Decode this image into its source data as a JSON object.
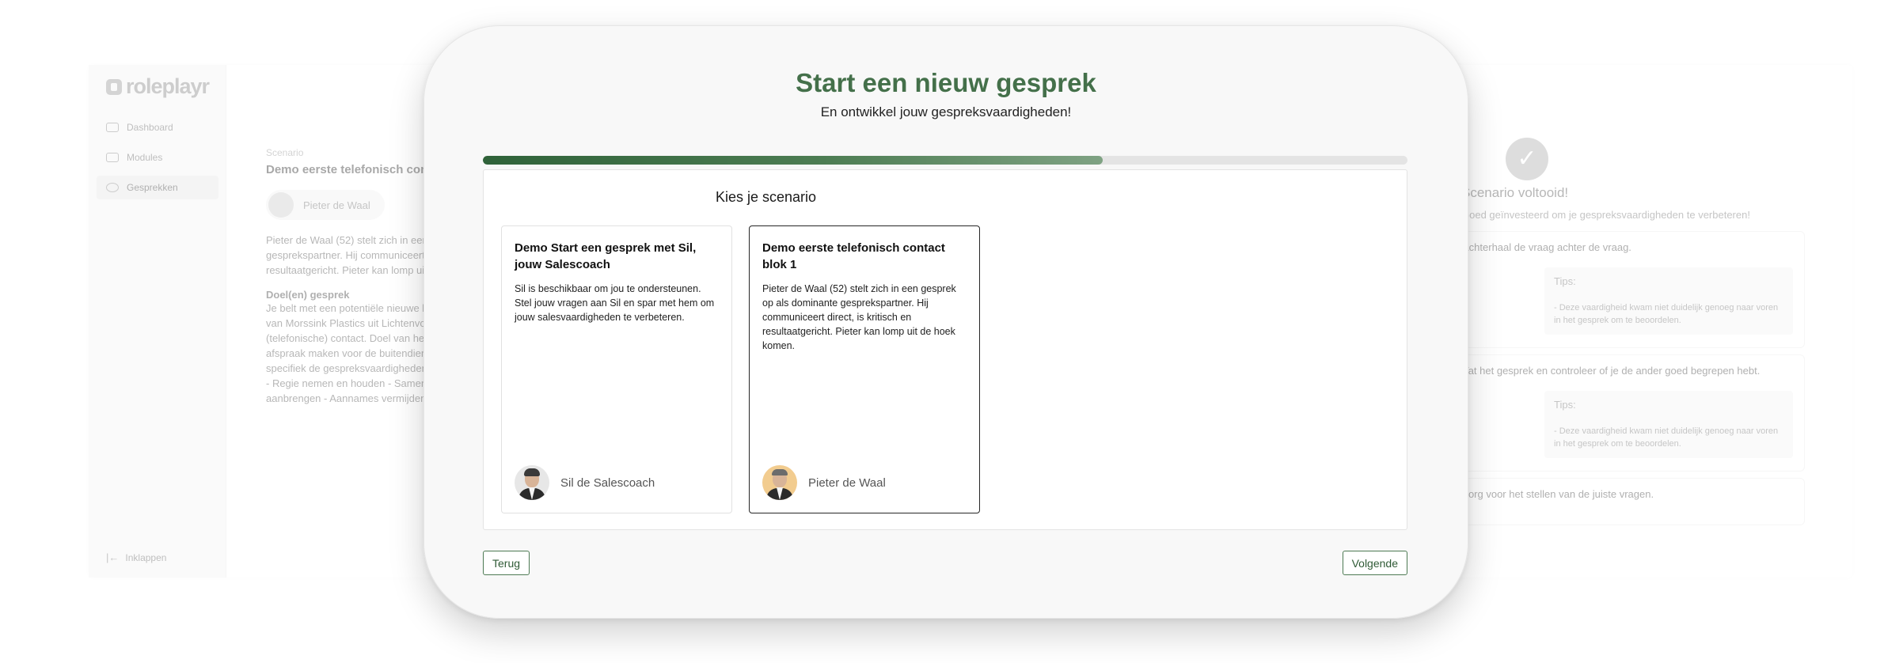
{
  "bg_left": {
    "logo": "roleplayr",
    "nav": [
      {
        "label": "Dashboard"
      },
      {
        "label": "Modules"
      },
      {
        "label": "Gesprekken"
      }
    ],
    "collapse": "Inklappen",
    "scenario_label": "Scenario",
    "scenario_title": "Demo eerste telefonisch contact blok 1",
    "persona": "Pieter de Waal",
    "description": "Pieter de Waal (52) stelt zich in een gesprek op als dominante gesprekspartner. Hij communiceert direct, is kritisch en resultaatgericht. Pieter kan lomp uit de hoek komen.",
    "goal_heading": "Doel(en) gesprek",
    "goal_text": "Je belt met een potentiële nieuwe klant, de operationeel manager van Morssink Plastics uit Lichtenvoorde. Het is het eerste (telefonische) contact. Doel van het gesprek is contact leggen en afspraak maken voor de buitendienst. Je oefent in dit gesprek specifiek de gespreksvaardigheden: - Actief luisteren - Doorvragen - Regie nemen en houden - Samenvatten - Gespreksstructuur aanbrengen - Aannames vermijden - Open vragen stellen"
  },
  "bg_right": {
    "done_title": "Scenario voltooid!",
    "done_sub": "Goed geïnvesteerd om je gespreksvaardigheden te verbeteren!",
    "feedback": [
      {
        "question": "Achterhaal de vraag achter de vraag.",
        "tips_heading": "Tips:",
        "tip": "- Deze vaardigheid kwam niet duidelijk genoeg naar voren in het gesprek om te beoordelen."
      },
      {
        "question": "Vat het gesprek en controleer of je de ander goed begrepen hebt.",
        "tips_heading": "Tips:",
        "tip": "- Deze vaardigheid kwam niet duidelijk genoeg naar voren in het gesprek om te beoordelen."
      },
      {
        "question": "Zorg voor het stellen van de juiste vragen."
      }
    ]
  },
  "modal": {
    "title": "Start een nieuw gesprek",
    "subtitle": "En ontwikkel jouw gespreksvaardigheden!",
    "progress_fraction": 0.67,
    "section_title": "Kies je scenario",
    "cards": [
      {
        "title": "Demo Start een gesprek met Sil, jouw Salescoach",
        "description": "Sil is beschikbaar om jou te ondersteunen. Stel jouw vragen aan Sil en spar met hem om jouw salesvaardigheden te verbeteren.",
        "persona": "Sil de Salescoach",
        "selected": false
      },
      {
        "title": "Demo eerste telefonisch contact blok 1",
        "description": "Pieter de Waal (52) stelt zich in een gesprek op als dominante gesprekspartner. Hij communiceert direct, is kritisch en resultaatgericht. Pieter kan lomp uit de hoek komen.",
        "persona": "Pieter de Waal",
        "selected": true
      }
    ],
    "back_label": "Terug",
    "next_label": "Volgende"
  },
  "colors": {
    "accent": "#44704a",
    "progress": "#2f6239",
    "track": "#e4e4e4"
  }
}
